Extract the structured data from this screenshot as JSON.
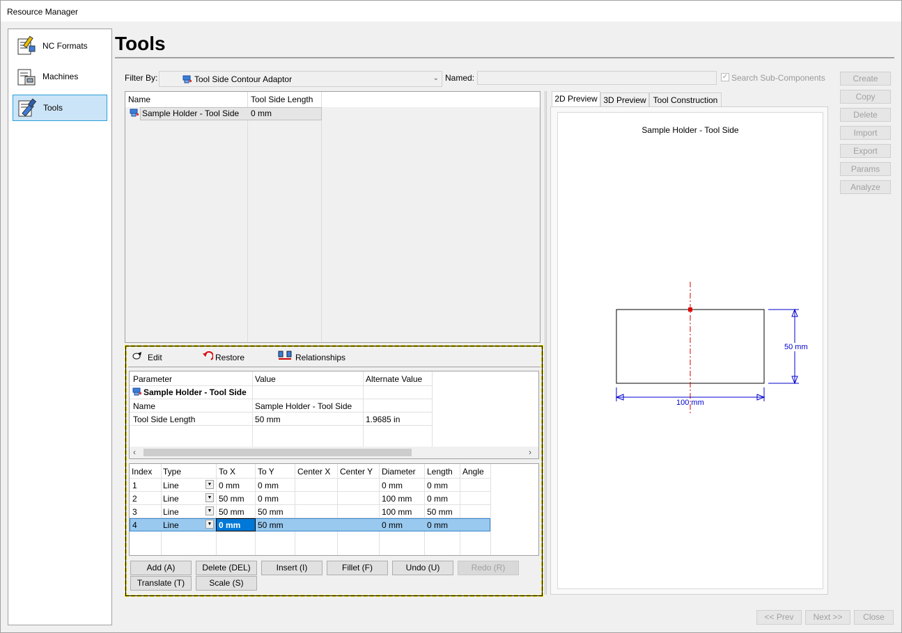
{
  "window": {
    "title": "Resource Manager"
  },
  "nav": [
    {
      "label": "NC Formats",
      "icon": "nc-formats-icon"
    },
    {
      "label": "Machines",
      "icon": "machines-icon"
    },
    {
      "label": "Tools",
      "icon": "tools-icon"
    }
  ],
  "page": {
    "title": "Tools"
  },
  "filter": {
    "label": "Filter By:",
    "value": "Tool Side Contour Adaptor",
    "named_label": "Named:",
    "named_value": "",
    "search_sub": "Search Sub-Components"
  },
  "side_buttons": [
    "Create",
    "Copy",
    "Delete",
    "Import",
    "Export",
    "Params",
    "Analyze"
  ],
  "tool_list": {
    "headers": [
      "Name",
      "Tool Side Length"
    ],
    "rows": [
      {
        "name": "Sample Holder - Tool Side",
        "length": "0 mm"
      }
    ]
  },
  "toolbar": {
    "edit": "Edit",
    "restore": "Restore",
    "relationships": "Relationships"
  },
  "params": {
    "headers": [
      "Parameter",
      "Value",
      "Alternate Value"
    ],
    "group": "Sample Holder - Tool Side",
    "rows": [
      {
        "p": "Name",
        "v": "Sample Holder - Tool Side",
        "a": ""
      },
      {
        "p": "Tool Side Length",
        "v": "50 mm",
        "a": "1.9685 in"
      }
    ]
  },
  "contour": {
    "headers": [
      "Index",
      "Type",
      "To X",
      "To Y",
      "Center X",
      "Center Y",
      "Diameter",
      "Length",
      "Angle"
    ],
    "rows": [
      {
        "i": "1",
        "t": "Line",
        "x": "0 mm",
        "y": "0 mm",
        "cx": "",
        "cy": "",
        "d": "0 mm",
        "l": "0 mm",
        "a": ""
      },
      {
        "i": "2",
        "t": "Line",
        "x": "50 mm",
        "y": "0 mm",
        "cx": "",
        "cy": "",
        "d": "100 mm",
        "l": "0 mm",
        "a": ""
      },
      {
        "i": "3",
        "t": "Line",
        "x": "50 mm",
        "y": "50 mm",
        "cx": "",
        "cy": "",
        "d": "100 mm",
        "l": "50 mm",
        "a": ""
      },
      {
        "i": "4",
        "t": "Line",
        "x": "0 mm",
        "y": "50 mm",
        "cx": "",
        "cy": "",
        "d": "0 mm",
        "l": "0 mm",
        "a": ""
      }
    ]
  },
  "contour_buttons": [
    "Add (A)",
    "Delete (DEL)",
    "Insert (I)",
    "Fillet (F)",
    "Undo (U)",
    "Redo (R)",
    "Translate (T)",
    "Scale (S)"
  ],
  "preview": {
    "tabs": [
      "2D Preview",
      "3D Preview",
      "Tool Construction"
    ],
    "title": "Sample Holder - Tool Side",
    "dim_height": "50 mm",
    "dim_width": "100 mm"
  },
  "footer": [
    "<< Prev",
    "Next >>",
    "Close"
  ],
  "colors": {
    "selection": "#cce4f7",
    "accent": "#26a0da",
    "highlight_row": "#99c9ef",
    "dim": "#0000cc",
    "axis": "#cc0000",
    "dashed_border": "#e8d800"
  }
}
